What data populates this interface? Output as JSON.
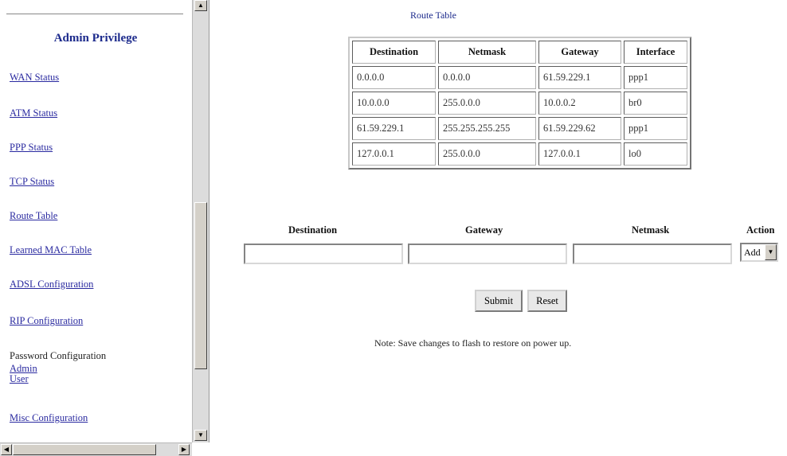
{
  "sidebar": {
    "title": "Admin Privilege",
    "items": {
      "wan": "WAN Status",
      "atm": "ATM Status",
      "ppp": "PPP Status",
      "tcp": "TCP Status",
      "route": "Route Table",
      "mac": "Learned MAC Table",
      "adsl": "ADSL Configuration",
      "rip": "RIP Configuration",
      "password": "Password Configuration",
      "admin": "Admin",
      "user": "User",
      "misc": "Misc Configuration"
    }
  },
  "main": {
    "title": "Route Table",
    "table": {
      "headers": [
        "Destination",
        "Netmask",
        "Gateway",
        "Interface"
      ],
      "rows": [
        [
          "0.0.0.0",
          "0.0.0.0",
          "61.59.229.1",
          "ppp1"
        ],
        [
          "10.0.0.0",
          "255.0.0.0",
          "10.0.0.2",
          "br0"
        ],
        [
          "61.59.229.1",
          "255.255.255.255",
          "61.59.229.62",
          "ppp1"
        ],
        [
          "127.0.0.1",
          "255.0.0.0",
          "127.0.0.1",
          "lo0"
        ]
      ]
    },
    "form": {
      "destination_label": "Destination",
      "gateway_label": "Gateway",
      "netmask_label": "Netmask",
      "action_label": "Action",
      "destination_value": "",
      "gateway_value": "",
      "netmask_value": "",
      "action_selected": "Add"
    },
    "buttons": {
      "submit": "Submit",
      "reset": "Reset"
    },
    "note": "Note: Save changes to flash to restore on power up."
  }
}
